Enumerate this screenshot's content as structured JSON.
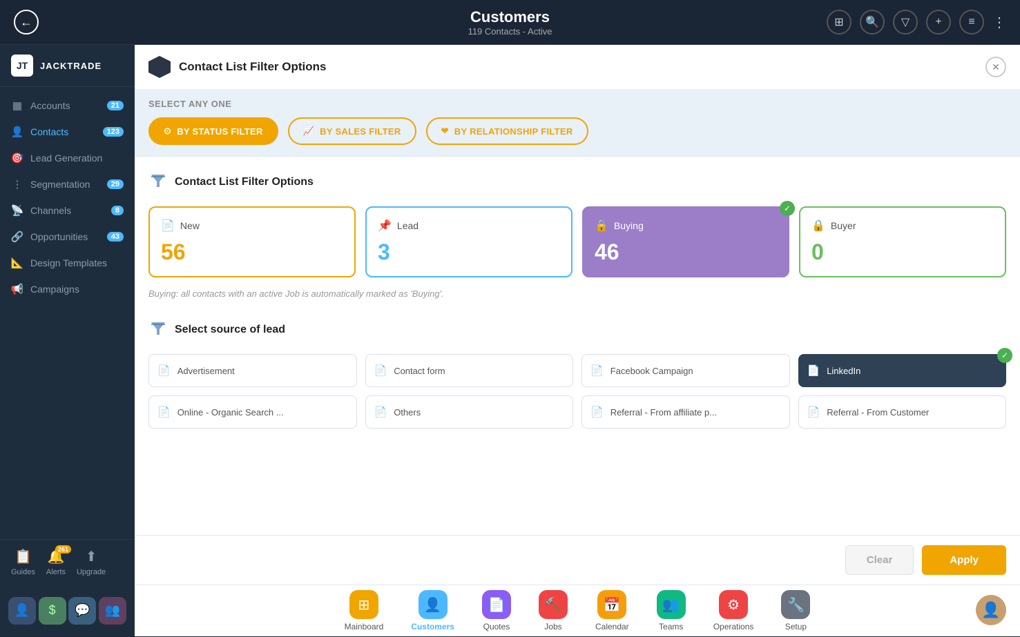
{
  "header": {
    "back_label": "◀",
    "title": "Customers",
    "subtitle": "119 Contacts - Active",
    "icons": [
      "⊞",
      "⊕",
      "▽",
      "+",
      "≡",
      "⋮"
    ]
  },
  "sidebar": {
    "logo": {
      "icon": "JT",
      "text": "JACKTRADE"
    },
    "items": [
      {
        "id": "accounts",
        "label": "Accounts",
        "badge": "21",
        "active": false,
        "icon": "▦"
      },
      {
        "id": "contacts",
        "label": "Contacts",
        "badge": "123",
        "active": true,
        "icon": "👤"
      },
      {
        "id": "lead-generation",
        "label": "Lead Generation",
        "badge": "",
        "active": false,
        "icon": "🎯"
      },
      {
        "id": "segmentation",
        "label": "Segmentation",
        "badge": "29",
        "active": false,
        "icon": "⊞"
      },
      {
        "id": "channels",
        "label": "Channels",
        "badge": "8",
        "active": false,
        "icon": "📡"
      },
      {
        "id": "opportunities",
        "label": "Opportunities",
        "badge": "43",
        "active": false,
        "icon": "🔗"
      },
      {
        "id": "design-templates",
        "label": "Design Templates",
        "badge": "",
        "active": false,
        "icon": "📐"
      },
      {
        "id": "campaigns",
        "label": "Campaigns",
        "badge": "",
        "active": false,
        "icon": "📢"
      }
    ],
    "bottom": [
      {
        "id": "guides",
        "label": "Guides",
        "icon": "📋",
        "badge": ""
      },
      {
        "id": "alerts",
        "label": "Alerts",
        "icon": "🔔",
        "badge": "261"
      },
      {
        "id": "upgrade",
        "label": "Upgrade",
        "icon": "⬆",
        "badge": ""
      }
    ]
  },
  "filter_panel": {
    "header_title": "Contact List Filter Options",
    "select_label": "SELECT ANY ONE",
    "filter_buttons": [
      {
        "id": "status",
        "label": "BY STATUS FILTER",
        "active": true
      },
      {
        "id": "sales",
        "label": "BY SALES FILTER",
        "active": false
      },
      {
        "id": "relationship",
        "label": "BY RELATIONSHIP FILTER",
        "active": false
      }
    ],
    "section1_title": "Contact List Filter Options",
    "status_cards": [
      {
        "id": "new",
        "label": "New",
        "value": "56",
        "style": "selected-yellow",
        "checked": false
      },
      {
        "id": "lead",
        "label": "Lead",
        "value": "3",
        "style": "selected-blue",
        "checked": false
      },
      {
        "id": "buying",
        "label": "Buying",
        "value": "46",
        "style": "selected-purple",
        "checked": true
      },
      {
        "id": "buyer",
        "label": "Buyer",
        "value": "0",
        "style": "selected-green",
        "checked": false
      }
    ],
    "buying_note": "Buying: all contacts with an active Job is automatically marked as 'Buying'.",
    "section2_title": "Select source of lead",
    "source_cards": [
      {
        "id": "advertisement",
        "label": "Advertisement",
        "selected": false
      },
      {
        "id": "contact-form",
        "label": "Contact form",
        "selected": false
      },
      {
        "id": "facebook-campaign",
        "label": "Facebook Campaign",
        "selected": false
      },
      {
        "id": "linkedin",
        "label": "LinkedIn",
        "selected": true
      },
      {
        "id": "online-organic",
        "label": "Online - Organic Search ...",
        "selected": false
      },
      {
        "id": "others",
        "label": "Others",
        "selected": false
      },
      {
        "id": "referral-affiliate",
        "label": "Referral - From affiliate p...",
        "selected": false
      },
      {
        "id": "referral-customer",
        "label": "Referral - From Customer",
        "selected": false
      }
    ],
    "clear_label": "Clear",
    "apply_label": "Apply"
  },
  "bottom_nav": {
    "items": [
      {
        "id": "mainboard",
        "label": "Mainboard",
        "icon_class": "nav-icon-mainboard",
        "icon": "⊞",
        "active": false
      },
      {
        "id": "customers",
        "label": "Customers",
        "icon_class": "nav-icon-customers",
        "icon": "👤",
        "active": true
      },
      {
        "id": "quotes",
        "label": "Quotes",
        "icon_class": "nav-icon-quotes",
        "icon": "📄",
        "active": false
      },
      {
        "id": "jobs",
        "label": "Jobs",
        "icon_class": "nav-icon-jobs",
        "icon": "🔨",
        "active": false
      },
      {
        "id": "calendar",
        "label": "Calendar",
        "icon_class": "nav-icon-calendar",
        "icon": "📅",
        "active": false
      },
      {
        "id": "teams",
        "label": "Teams",
        "icon_class": "nav-icon-teams",
        "icon": "👥",
        "active": false
      },
      {
        "id": "operations",
        "label": "Operations",
        "icon_class": "nav-icon-operations",
        "icon": "⚙",
        "active": false
      },
      {
        "id": "setup",
        "label": "Setup",
        "icon_class": "nav-icon-setup",
        "icon": "🔧",
        "active": false
      }
    ]
  }
}
